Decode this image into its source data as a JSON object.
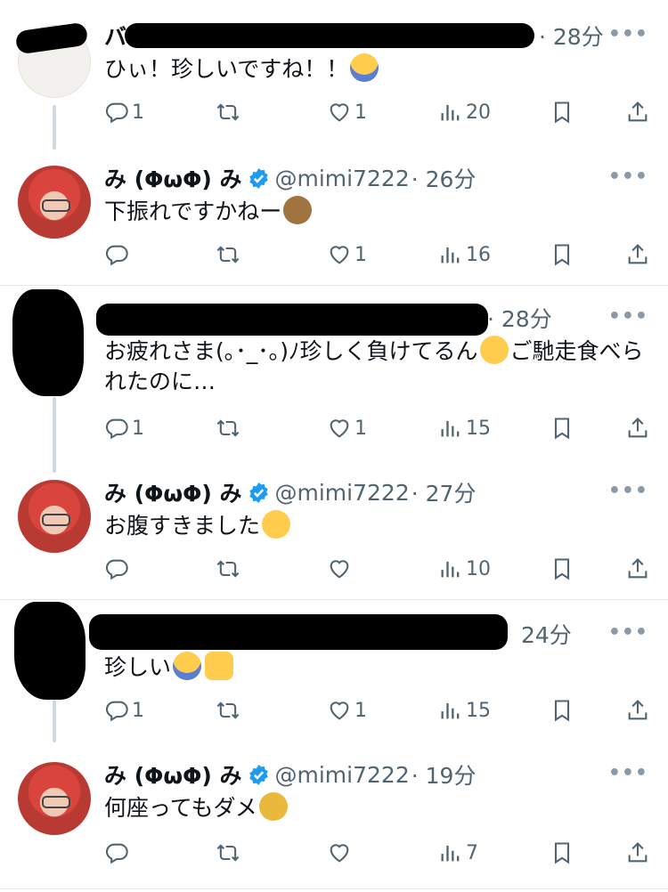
{
  "tweets": [
    {
      "name": "バ",
      "time": "· 28分",
      "text": "ひぃ！珍しいですね！！",
      "emoji": "screaming-face",
      "replies": "1",
      "retweets": "",
      "likes": "1",
      "views": "20"
    },
    {
      "name": "み (ΦωΦ) み",
      "handle": "@mimi7222",
      "time": "· 26分",
      "text": "下振れですかねー",
      "emoji": "see-no-evil-monkey",
      "replies": "",
      "retweets": "",
      "likes": "1",
      "views": "16"
    },
    {
      "time": "· 28分",
      "text": "お疲れさま(｡･_･｡)ﾉ珍しく負けてるん",
      "text2": "ご馳走食べられたのに…",
      "emoji": "sad-relieved-face",
      "replies": "1",
      "retweets": "",
      "likes": "1",
      "views": "15"
    },
    {
      "name": "み (ΦωΦ) み",
      "handle": "@mimi7222",
      "time": "· 27分",
      "text": "お腹すきました",
      "emoji": "pleading-face",
      "replies": "",
      "retweets": "",
      "likes": "",
      "views": "10"
    },
    {
      "time": "24分",
      "text": "珍しい",
      "emoji": "screaming-face",
      "emoji2": "raising-hands",
      "replies": "1",
      "retweets": "",
      "likes": "1",
      "views": "15"
    },
    {
      "name": "み (ΦωΦ) み",
      "handle": "@mimi7222",
      "time": "· 19分",
      "text": "何座ってもダメ",
      "emoji": "person-shrugging",
      "replies": "",
      "retweets": "",
      "likes": "",
      "views": "7"
    }
  ],
  "more_label": "•••",
  "colors": {
    "verified": "#1d9bf0",
    "muted": "#536471",
    "divider": "#e1e8ed"
  }
}
